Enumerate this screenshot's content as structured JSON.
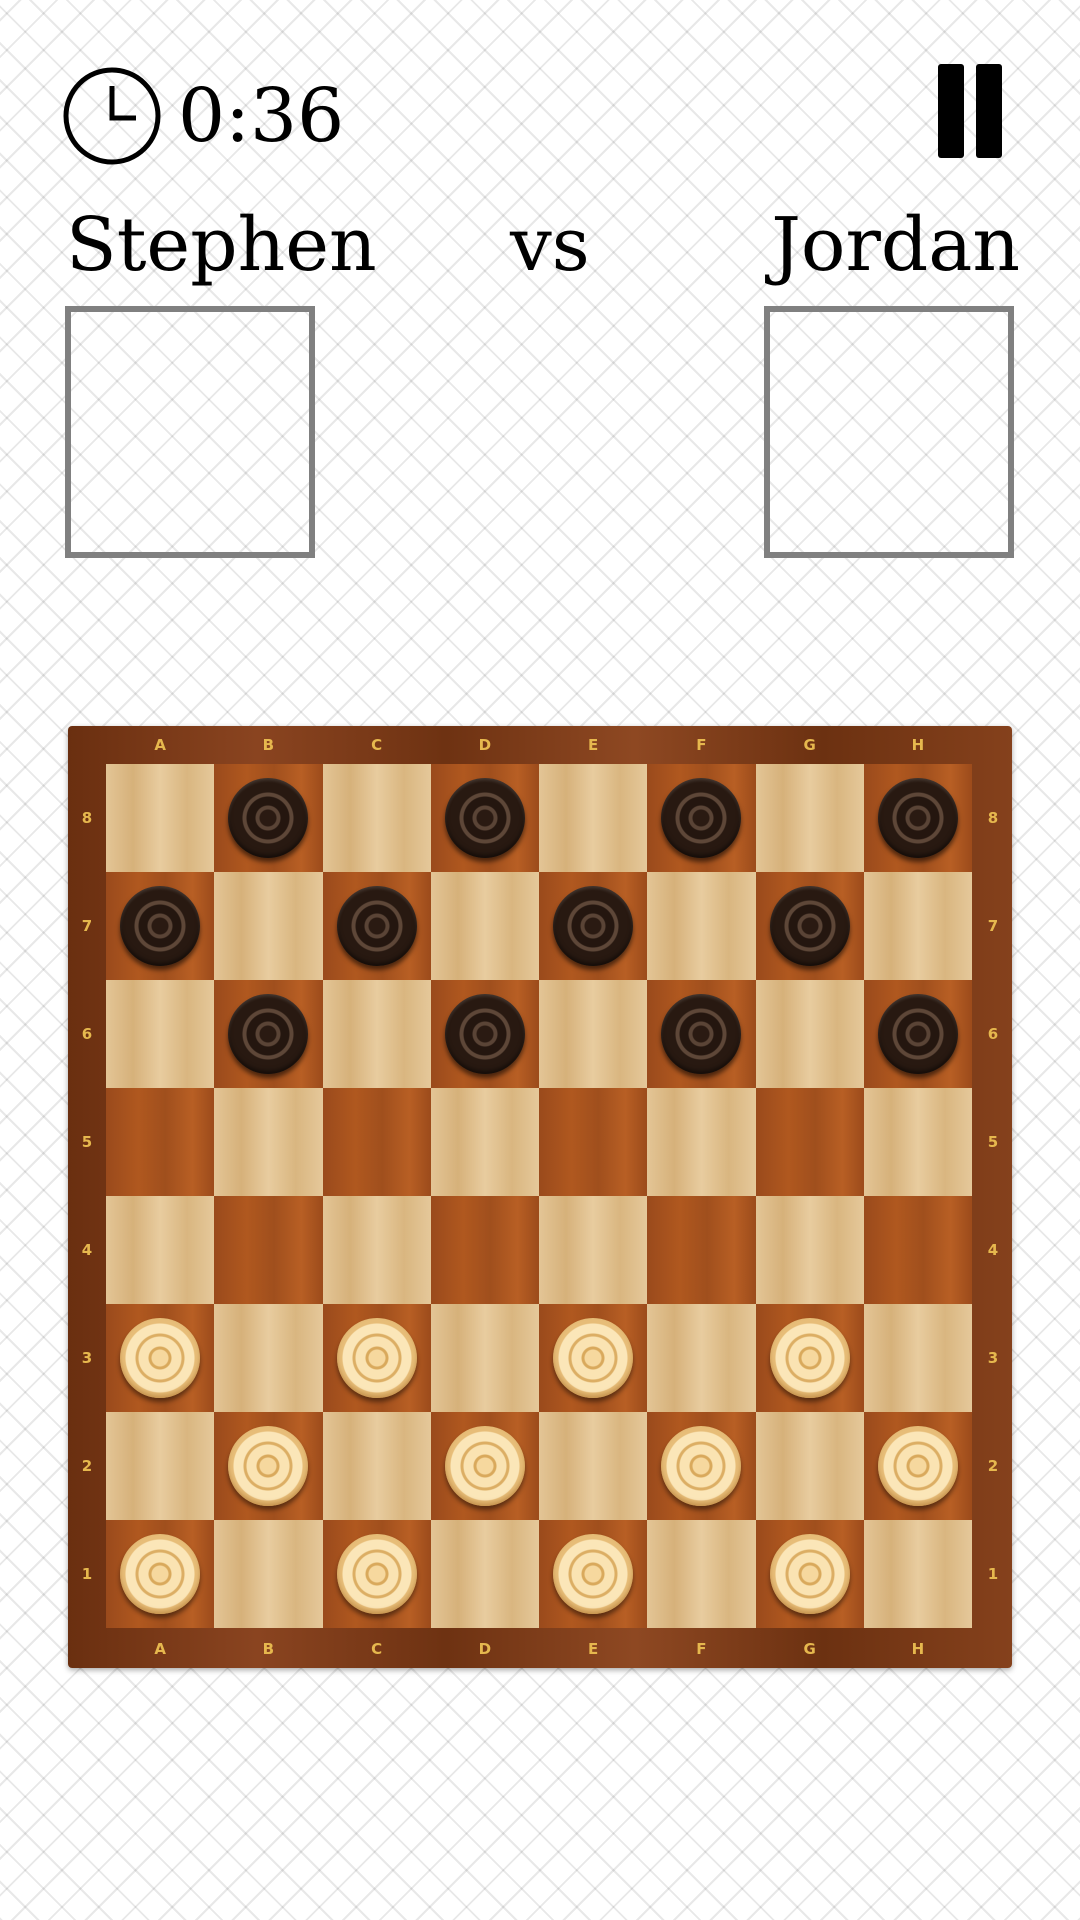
{
  "header": {
    "timer_icon": "clock-icon",
    "timer": "0:36",
    "pause_icon": "pause-icon"
  },
  "players": {
    "left_name": "Stephen",
    "versus": "vs",
    "right_name": "Jordan"
  },
  "board": {
    "files": [
      "A",
      "B",
      "C",
      "D",
      "E",
      "F",
      "G",
      "H"
    ],
    "ranks": [
      "8",
      "7",
      "6",
      "5",
      "4",
      "3",
      "2",
      "1"
    ],
    "pieces": [
      {
        "square": "B8",
        "color": "black"
      },
      {
        "square": "D8",
        "color": "black"
      },
      {
        "square": "F8",
        "color": "black"
      },
      {
        "square": "H8",
        "color": "black"
      },
      {
        "square": "A7",
        "color": "black"
      },
      {
        "square": "C7",
        "color": "black"
      },
      {
        "square": "E7",
        "color": "black"
      },
      {
        "square": "G7",
        "color": "black"
      },
      {
        "square": "B6",
        "color": "black"
      },
      {
        "square": "D6",
        "color": "black"
      },
      {
        "square": "F6",
        "color": "black"
      },
      {
        "square": "H6",
        "color": "black"
      },
      {
        "square": "A3",
        "color": "white"
      },
      {
        "square": "C3",
        "color": "white"
      },
      {
        "square": "E3",
        "color": "white"
      },
      {
        "square": "G3",
        "color": "white"
      },
      {
        "square": "B2",
        "color": "white"
      },
      {
        "square": "D2",
        "color": "white"
      },
      {
        "square": "F2",
        "color": "white"
      },
      {
        "square": "H2",
        "color": "white"
      },
      {
        "square": "A1",
        "color": "white"
      },
      {
        "square": "C1",
        "color": "white"
      },
      {
        "square": "E1",
        "color": "white"
      },
      {
        "square": "G1",
        "color": "white"
      }
    ]
  }
}
